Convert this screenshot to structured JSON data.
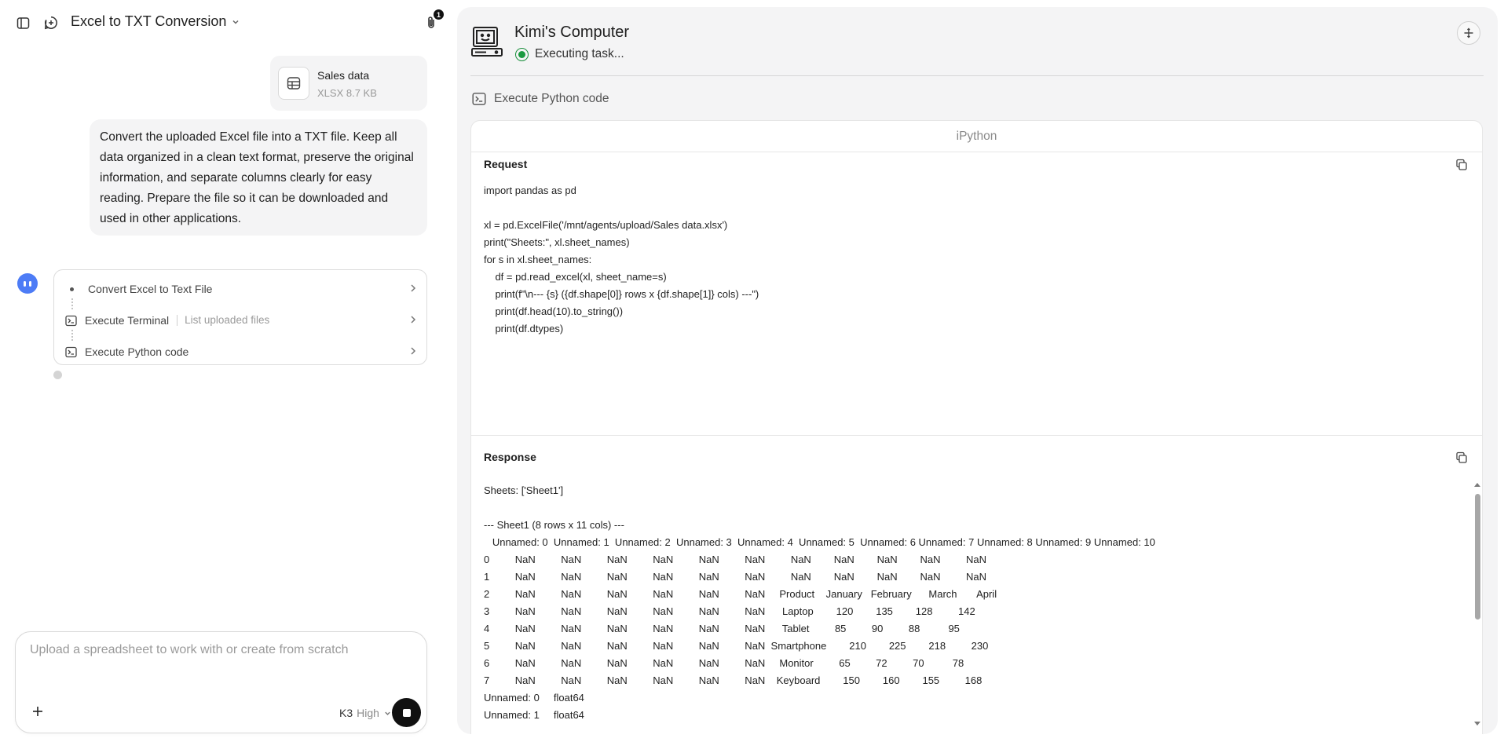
{
  "header": {
    "title": "Excel to TXT Conversion",
    "attachments_count": "1"
  },
  "file": {
    "name": "Sales data",
    "meta": "XLSX 8.7 KB"
  },
  "user_message": "Convert the uploaded Excel file into a TXT file. Keep all data organized in a clean text format, preserve the original information, and separate columns clearly for easy reading. Prepare the file so it can be downloaded and used in other applications.",
  "steps": [
    {
      "label": "Convert Excel to Text File",
      "sub": ""
    },
    {
      "label": "Execute Terminal",
      "sub": "List uploaded files"
    },
    {
      "label": "Execute Python code",
      "sub": ""
    }
  ],
  "composer": {
    "placeholder": "Upload a spreadsheet to work with or create from scratch",
    "model_name": "K3",
    "model_mode": "High"
  },
  "computer": {
    "title": "Kimi's Computer",
    "status": "Executing task...",
    "tool": "Execute Python code",
    "panel_title": "iPython",
    "request_label": "Request",
    "response_label": "Response",
    "request_code": "import pandas as pd\n\nxl = pd.ExcelFile('/mnt/agents/upload/Sales data.xlsx')\nprint(\"Sheets:\", xl.sheet_names)\nfor s in xl.sheet_names:\n    df = pd.read_excel(xl, sheet_name=s)\n    print(f\"\\n--- {s} ({df.shape[0]} rows x {df.shape[1]} cols) ---\")\n    print(df.head(10).to_string())\n    print(df.dtypes)",
    "response_text": "Sheets: ['Sheet1']\n\n--- Sheet1 (8 rows x 11 cols) ---\n   Unnamed: 0  Unnamed: 1  Unnamed: 2  Unnamed: 3  Unnamed: 4  Unnamed: 5  Unnamed: 6 Unnamed: 7 Unnamed: 8 Unnamed: 9 Unnamed: 10\n0         NaN         NaN         NaN         NaN         NaN         NaN         NaN        NaN        NaN        NaN         NaN\n1         NaN         NaN         NaN         NaN         NaN         NaN         NaN        NaN        NaN        NaN         NaN\n2         NaN         NaN         NaN         NaN         NaN         NaN     Product    January   February      March       April\n3         NaN         NaN         NaN         NaN         NaN         NaN      Laptop        120        135        128         142\n4         NaN         NaN         NaN         NaN         NaN         NaN      Tablet         85         90         88          95\n5         NaN         NaN         NaN         NaN         NaN         NaN  Smartphone        210        225        218         230\n6         NaN         NaN         NaN         NaN         NaN         NaN     Monitor         65         72         70          78\n7         NaN         NaN         NaN         NaN         NaN         NaN    Keyboard        150        160        155         168\nUnnamed: 0     float64\nUnnamed: 1     float64"
  },
  "colors": {
    "accent": "#4d7cf6",
    "status_green": "#1a9a40",
    "panel_bg": "#f4f4f5"
  }
}
